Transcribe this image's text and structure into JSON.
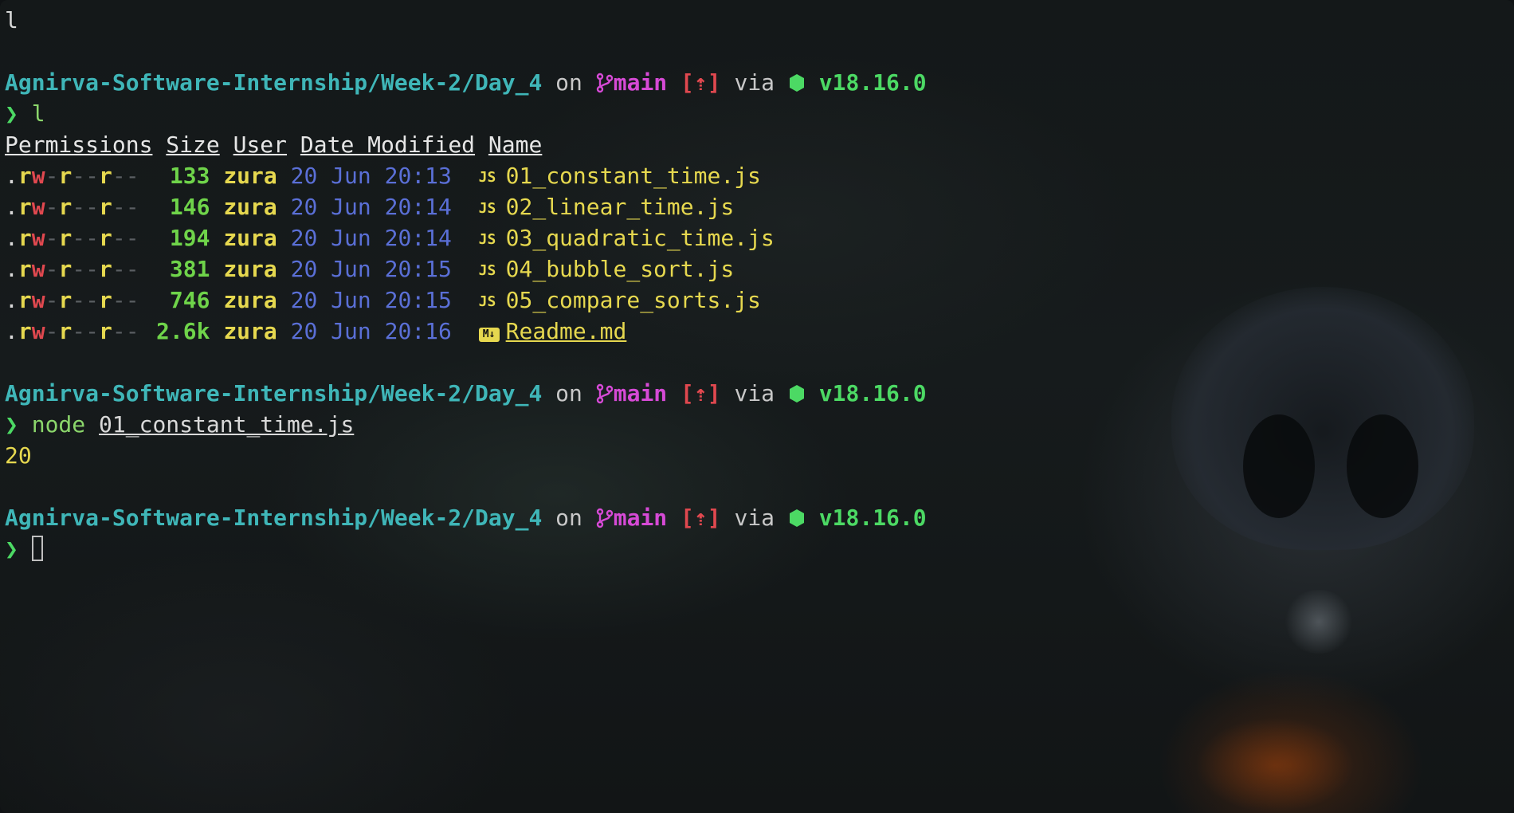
{
  "first_line": "l",
  "prompt": {
    "path": "Agnirva-Software-Internship/Week-2/Day_4",
    "on": "on",
    "branch": "main",
    "status": "[⇡]",
    "via": "via",
    "node_version": "v18.16.0",
    "symbol": "❯"
  },
  "commands": {
    "ls": "l",
    "node": "node",
    "node_arg": "01_constant_time.js"
  },
  "listing": {
    "headers": [
      "Permissions",
      "Size",
      "User",
      "Date Modified",
      "Name"
    ],
    "rows": [
      {
        "size": "133",
        "user": "zura",
        "date": "20 Jun 20:13",
        "icon": "js-icon",
        "name": "01_constant_time.js"
      },
      {
        "size": "146",
        "user": "zura",
        "date": "20 Jun 20:14",
        "icon": "js-icon",
        "name": "02_linear_time.js"
      },
      {
        "size": "194",
        "user": "zura",
        "date": "20 Jun 20:14",
        "icon": "js-icon",
        "name": "03_quadratic_time.js"
      },
      {
        "size": "381",
        "user": "zura",
        "date": "20 Jun 20:15",
        "icon": "js-icon",
        "name": "04_bubble_sort.js"
      },
      {
        "size": "746",
        "user": "zura",
        "date": "20 Jun 20:15",
        "icon": "js-icon",
        "name": "05_compare_sorts.js"
      },
      {
        "size": "2.6k",
        "user": "zura",
        "date": "20 Jun 20:16",
        "icon": "markdown-icon",
        "name": "Readme.md"
      }
    ]
  },
  "output": "20",
  "colors": {
    "path": "#3fb6b8",
    "branch": "#d64ad6",
    "status": "#e0484f",
    "node": "#4cd964",
    "user": "#e6d84f",
    "date": "#5a6fd6"
  }
}
